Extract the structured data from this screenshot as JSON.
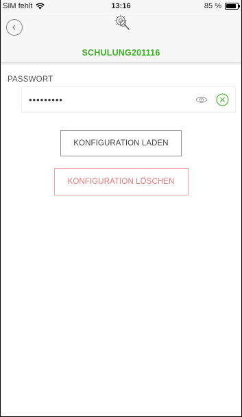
{
  "status_bar": {
    "carrier": "SIM fehlt",
    "time": "13:16",
    "battery": "85 %",
    "battery_level": 0.85,
    "icons": [
      "wifi-icon",
      "battery-icon"
    ]
  },
  "header": {
    "title": "SCHULUNG201116",
    "title_color": "#3fae2a",
    "icons": [
      "back-icon",
      "gear-search-icon"
    ]
  },
  "password": {
    "label": "PASSWORT",
    "value": "•••••••••",
    "icons": [
      "eye-icon",
      "clear-icon"
    ],
    "clear_color": "#3fae2a"
  },
  "actions": {
    "load_label": "KONFIGURATION LADEN",
    "delete_label": "KONFIGURATION LÖSCHEN",
    "delete_color": "#e07a7a"
  }
}
